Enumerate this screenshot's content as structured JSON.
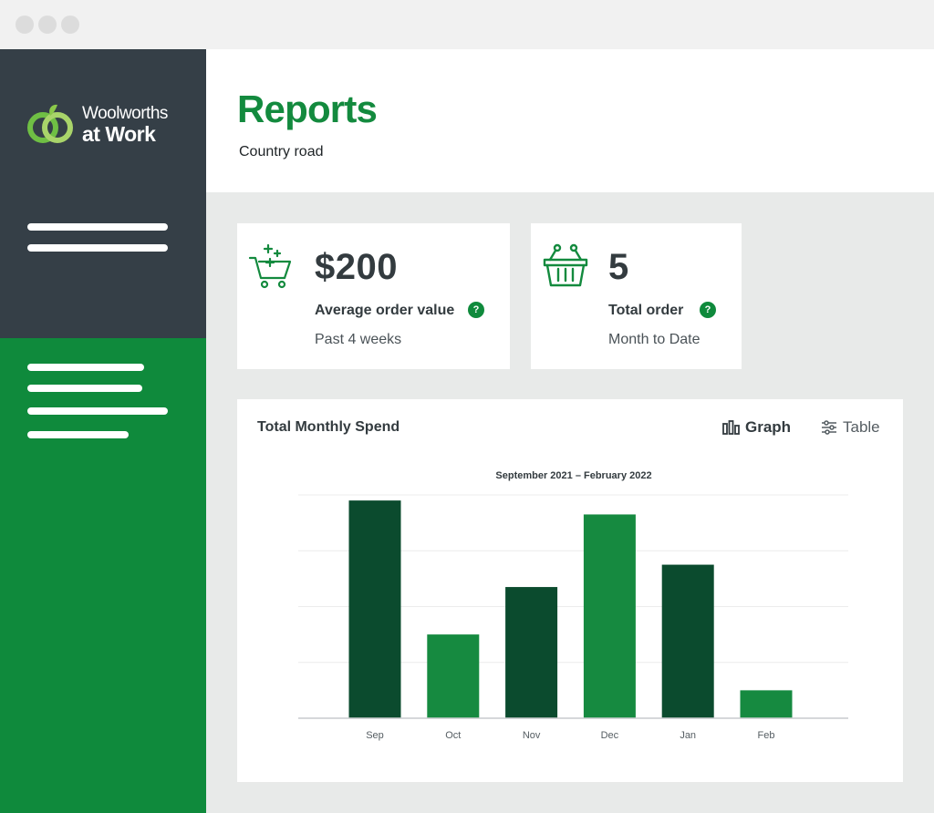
{
  "window": {
    "controls": [
      "close",
      "minimize",
      "maximize"
    ]
  },
  "brand": {
    "line1": "Woolworths",
    "line2": "at Work",
    "mark_icon": "woolworths-logo-icon"
  },
  "colors": {
    "brand_green": "#138a3e",
    "sidebar_dark": "#353f47",
    "sidebar_green": "#0f8a3c",
    "bar_dark": "#0b4b2e",
    "bar_light": "#168a40"
  },
  "header": {
    "title": "Reports",
    "subtitle": "Country road"
  },
  "stats": [
    {
      "icon": "cart-plus-icon",
      "value": "$200",
      "label": "Average order value",
      "help": "?",
      "period": "Past 4 weeks"
    },
    {
      "icon": "basket-icon",
      "value": "5",
      "label": "Total order",
      "help": "?",
      "period": "Month to Date"
    }
  ],
  "chart_panel": {
    "title": "Total Monthly Spend",
    "view_toggle": {
      "graph_label": "Graph",
      "table_label": "Table",
      "selected": "Graph"
    }
  },
  "chart_data": {
    "type": "bar",
    "title": "September 2021 – February 2022",
    "categories": [
      "Sep",
      "Oct",
      "Nov",
      "Dec",
      "Jan",
      "Feb"
    ],
    "values": [
      390,
      150,
      235,
      365,
      275,
      50
    ],
    "bar_colors": [
      "#0b4b2e",
      "#168a40",
      "#0b4b2e",
      "#168a40",
      "#0b4b2e",
      "#168a40"
    ],
    "ylim": [
      0,
      400
    ],
    "grid": true,
    "xlabel": "",
    "ylabel": ""
  }
}
